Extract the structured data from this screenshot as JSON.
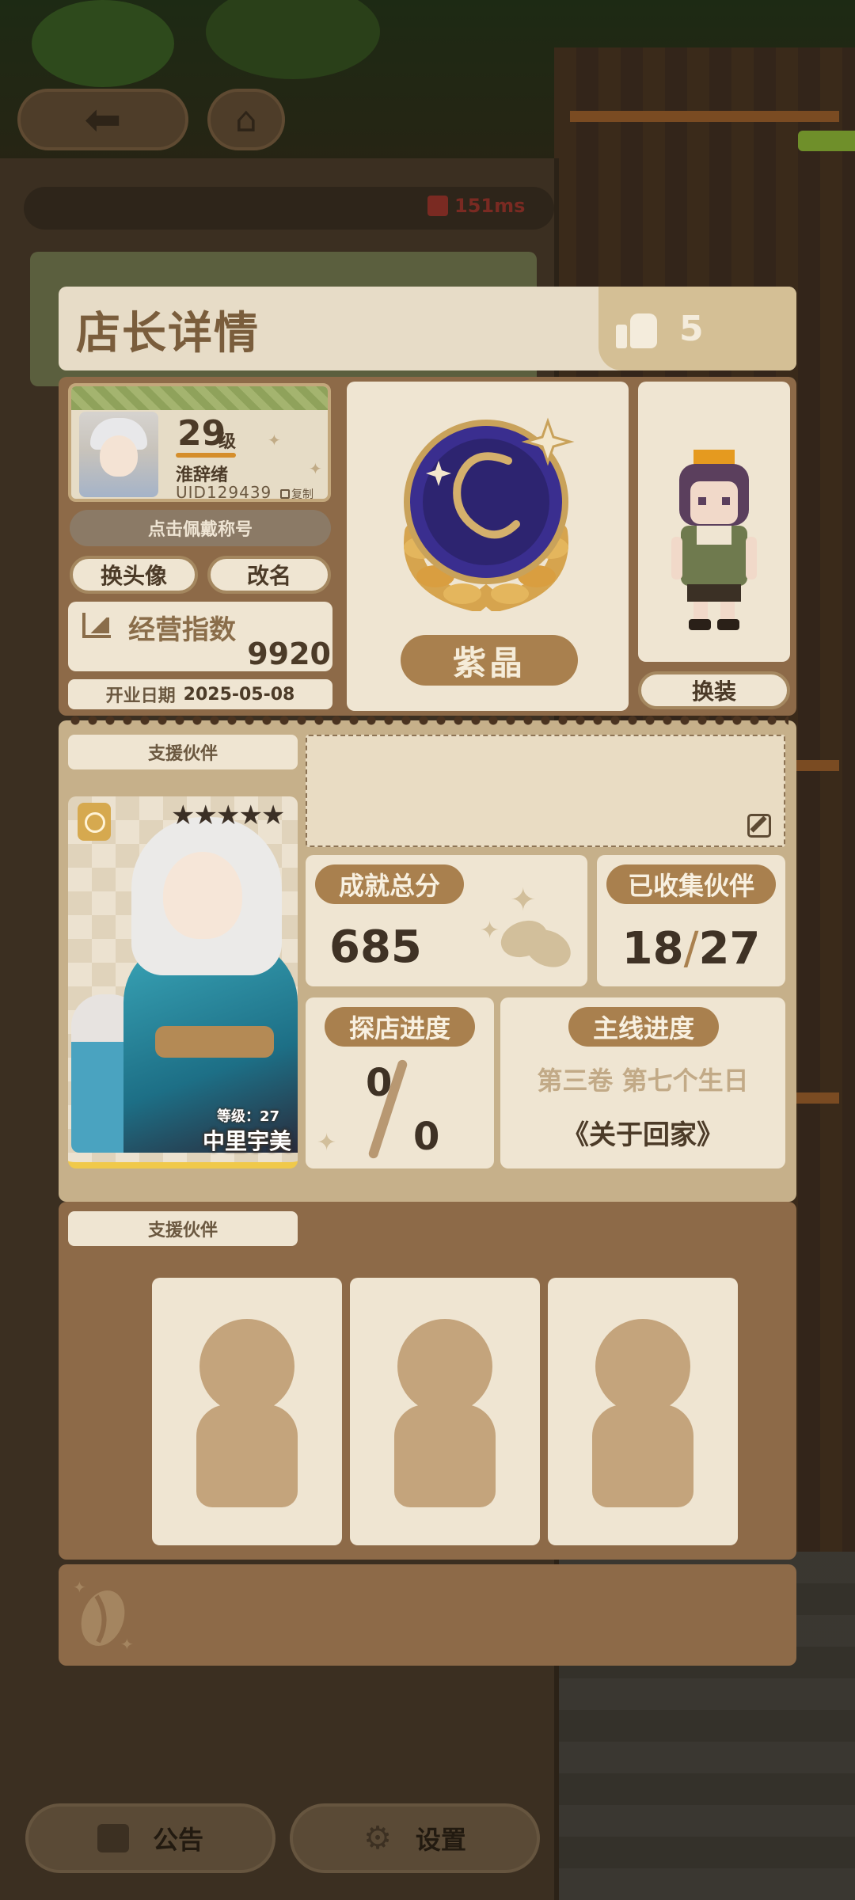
{
  "network": {
    "ping": "151ms"
  },
  "modal": {
    "title": "店长详情",
    "likes": "5",
    "profile": {
      "level": "29",
      "level_unit": "级",
      "name": "淮辞绪",
      "uid": "UID129439",
      "copy_label": "复制"
    },
    "title_wear_label": "点击佩戴称号",
    "change_avatar_label": "换头像",
    "rename_label": "改名",
    "business": {
      "label": "经营指数",
      "value": "9920"
    },
    "open_date": {
      "label": "开业日期",
      "value": "2025-05-08"
    },
    "rank": {
      "label": "紫晶",
      "color": "#3a2e8f"
    },
    "outfit_label": "换装",
    "support_label": "支援伙伴",
    "support_partner": {
      "level": "等级：27",
      "name": "中里宇美",
      "stars": "★★★★★"
    },
    "achievement": {
      "label": "成就总分",
      "value": "685"
    },
    "collected": {
      "label": "已收集伙伴",
      "current": "18",
      "total": "27"
    },
    "explore": {
      "label": "探店进度",
      "current": "0",
      "total": "0"
    },
    "main_story": {
      "label": "主线进度",
      "chapter": "第三卷 第七个生日",
      "title": "《关于回家》"
    },
    "support_label_2": "支援伙伴"
  },
  "bottom": {
    "notice_label": "公告",
    "settings_label": "设置"
  },
  "colors": {
    "accent": "#a9804e",
    "panel": "#efe5d2",
    "frame": "#8d6a48"
  }
}
